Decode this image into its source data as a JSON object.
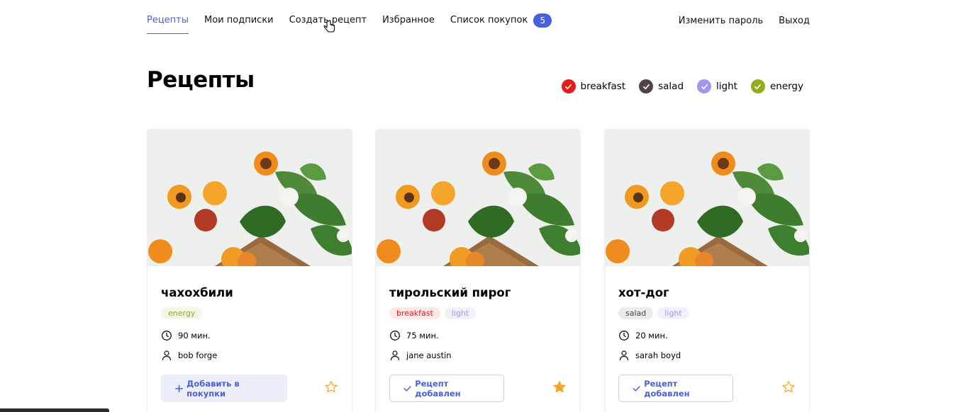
{
  "nav": {
    "items": [
      {
        "label": "Рецепты",
        "active": true
      },
      {
        "label": "Мои подписки"
      },
      {
        "label": "Создать рецепт"
      },
      {
        "label": "Избранное"
      },
      {
        "label": "Список покупок",
        "badge": "5"
      }
    ],
    "right": [
      {
        "label": "Изменить пароль"
      },
      {
        "label": "Выход"
      }
    ]
  },
  "page": {
    "title": "Рецепты"
  },
  "filters": [
    {
      "label": "breakfast",
      "color": "#e61c1c"
    },
    {
      "label": "salad",
      "color": "#4d4444"
    },
    {
      "label": "light",
      "color": "#a493f0"
    },
    {
      "label": "energy",
      "color": "#95aa1d"
    }
  ],
  "cards": [
    {
      "title": "чахохбили",
      "tags": [
        {
          "label": "energy",
          "color": "#95aa1d",
          "bg": "#f3f5e6"
        }
      ],
      "time": "90 мин.",
      "author": "bob forge",
      "button": "Добавить в покупки",
      "button_state": "add",
      "favorite": false
    },
    {
      "title": "тирольский пирог",
      "tags": [
        {
          "label": "breakfast",
          "color": "#e61c1c",
          "bg": "#fde8e8"
        },
        {
          "label": "light",
          "color": "#a493f0",
          "bg": "#f3f0fd"
        }
      ],
      "time": "75 мин.",
      "author": "jane austin",
      "button": "Рецепт добавлен",
      "button_state": "added",
      "favorite": true
    },
    {
      "title": "хот-дог",
      "tags": [
        {
          "label": "salad",
          "color": "#4d4444",
          "bg": "#ebebeb"
        },
        {
          "label": "light",
          "color": "#a493f0",
          "bg": "#f3f0fd"
        }
      ],
      "time": "20 мин.",
      "author": "sarah boyd",
      "button": "Рецепт добавлен",
      "button_state": "added",
      "favorite": false
    }
  ],
  "colors": {
    "accent": "#4a61dd",
    "star": "#f5a623"
  }
}
